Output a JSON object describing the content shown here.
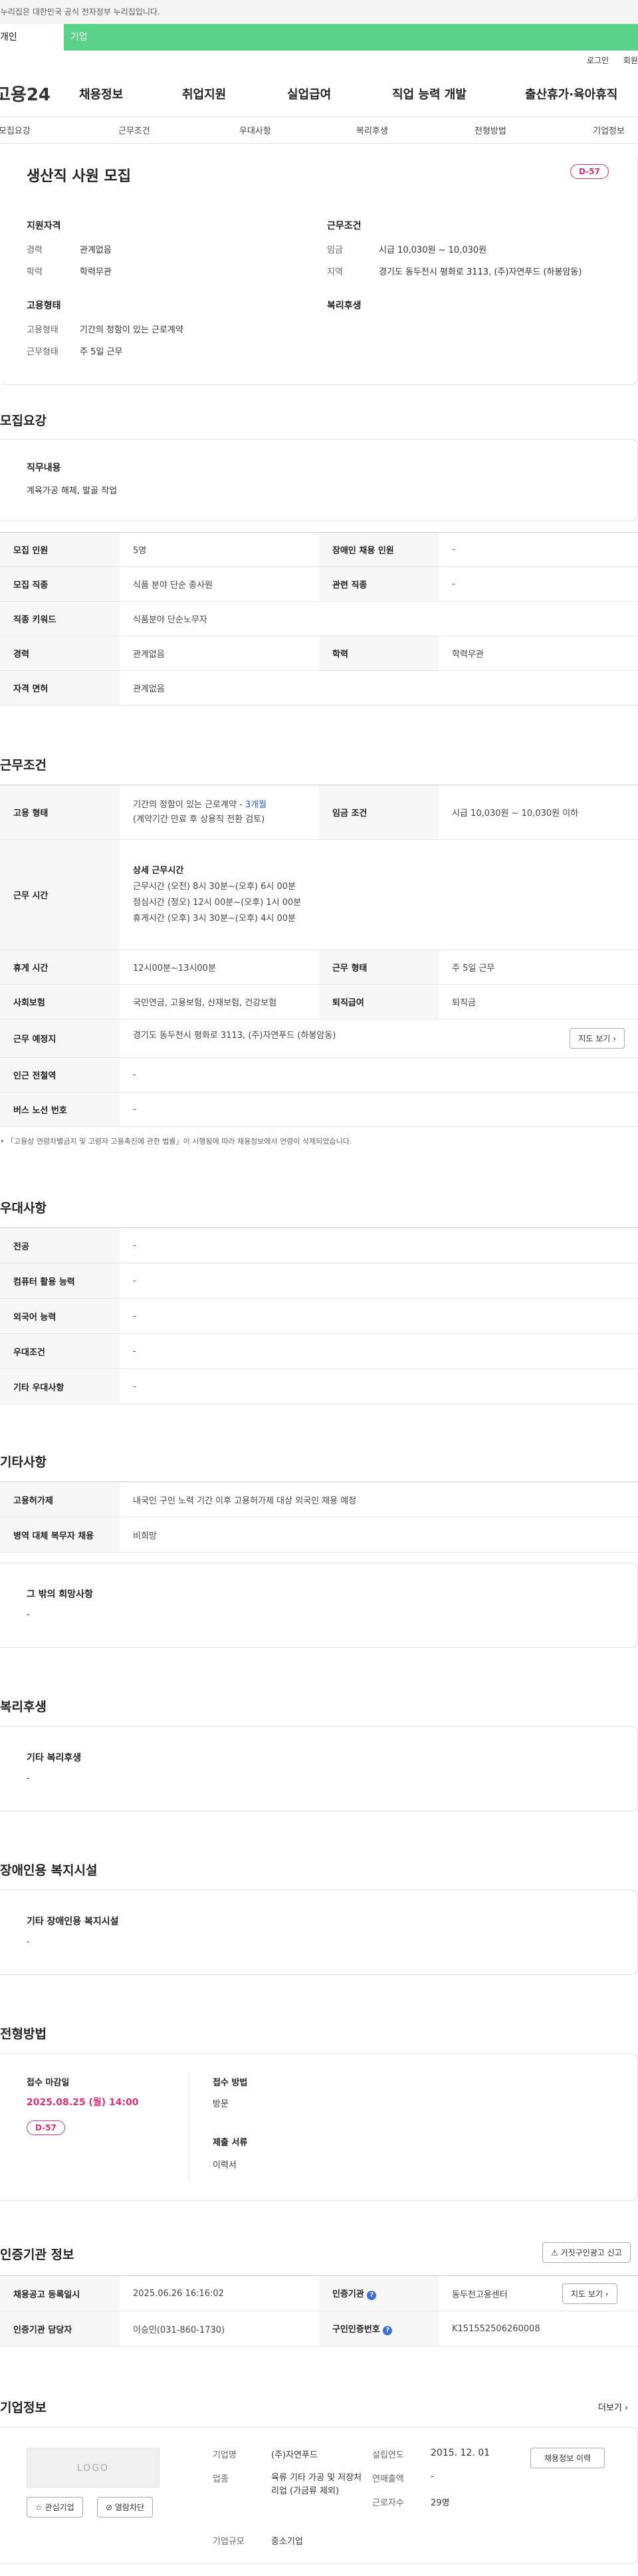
{
  "gov_bar": "이 누리집은 대한민국 공식 전자정부 누리집입니다.",
  "tabs": {
    "individual": "개인",
    "enterprise": "기업"
  },
  "util": {
    "login": "로그인",
    "signup": "회원가입"
  },
  "gnb": {
    "logo": "고용24",
    "menus": [
      "채용정보",
      "취업지원",
      "실업급여",
      "직업 능력 개발",
      "출산휴가·육아휴직"
    ]
  },
  "lnb": [
    "모집요강",
    "근무조건",
    "우대사항",
    "복리후생",
    "전형방법",
    "기업정보"
  ],
  "summary": {
    "title": "생산직 사원 모집",
    "dday": "D-57",
    "qualification_title": "지원자격",
    "career_label": "경력",
    "career_value": "관계없음",
    "education_label": "학력",
    "education_value": "학력무관",
    "conditions_title": "근무조건",
    "wage_label": "임금",
    "wage_value": "시급 10,030원 ~ 10,030원",
    "region_label": "지역",
    "region_value": "경기도 동두천시 평화로 3113, (주)자연푸드 (하봉암동)",
    "employment_title": "고용형태",
    "emp_type_label": "고용형태",
    "emp_type_value": "기간의 정함이 있는 근로계약",
    "work_form_label": "근무형태",
    "work_form_value": "주 5일 근무",
    "welfare_title": "복리후생"
  },
  "recruit": {
    "title": "모집요강",
    "duty_title": "직무내용",
    "duty_value": "계육가공  해체, 발골 작업",
    "rows": [
      {
        "k1": "모집 인원",
        "v1": "5명",
        "k2": "장애인 채용 인원",
        "v2": "-"
      },
      {
        "k1": "모집 직종",
        "v1": "식품 분야 단순 종사원",
        "k2": "관련 직종",
        "v2": "-"
      },
      {
        "k1": "직종 키워드",
        "v1": "식품분야 단순노무자"
      },
      {
        "k1": "경력",
        "v1": "관계없음",
        "k2": "학력",
        "v2": "학력무관"
      },
      {
        "k1": "자격 면허",
        "v1": "관계없음"
      }
    ]
  },
  "work": {
    "title": "근무조건",
    "emp_type_key": "고용 형태",
    "emp_type_v1": "기간의 정함이 있는 근로계약 - ",
    "emp_type_months": "3개월",
    "emp_type_v2": "(계약기간 만료 후 상용직 전환 검토)",
    "wage_key": "임금 조건",
    "wage_value": "시급 10,030원 ~ 10,030원 이하",
    "hours_key": "근무 시간",
    "hours_title": "상세 근무시간",
    "hours_lines": [
      "근무시간 (오전) 8시 30분~(오후) 6시 00분",
      "점심시간 (정오) 12시 00분~(오후) 1시 00분",
      "휴게시간 (오후) 3시 30분~(오후) 4시 00분"
    ],
    "rest_key": "휴게 시간",
    "rest_value": "12시00분~13시00분",
    "form_key": "근무 형태",
    "form_value": "주 5일 근무",
    "insurance_key": "사회보험",
    "insurance_value": "국민연금, 고용보험, 산재보험, 건강보험",
    "severance_key": "퇴직급여",
    "severance_value": "퇴직금",
    "place_key": "근무 예정지",
    "place_value": "경기도 동두천시 평화로 3113, (주)자연푸드 (하봉암동)",
    "map_button": "지도 보기",
    "subway_key": "인근 전철역",
    "subway_value": "-",
    "bus_key": "버스 노선 번호",
    "bus_value": "-",
    "note": "「고용상 연령차별금지 및 고령자 고용촉진에 관한 법률」이 시행됨에 따라 채용정보에서 연령이 삭제되었습니다."
  },
  "pref": {
    "title": "우대사항",
    "rows": [
      {
        "k": "전공",
        "v": "-"
      },
      {
        "k": "컴퓨터 활용 능력",
        "v": "-"
      },
      {
        "k": "외국어 능력",
        "v": "-"
      },
      {
        "k": "우대조건",
        "v": "-"
      },
      {
        "k": "기타 우대사항",
        "v": "-"
      }
    ]
  },
  "etc": {
    "title": "기타사항",
    "rows": [
      {
        "k": "고용허가제",
        "v": "내국인 구인 노력 기간 이후 고용허가제 대상 외국인 채용 예정"
      },
      {
        "k": "병역 대체 복무자 채용",
        "v": "비희망"
      }
    ],
    "other_title": "그 밖의 희망사항",
    "other_value": "-"
  },
  "welfare": {
    "title": "복리후생",
    "box_title": "기타 복리후생",
    "box_value": "-"
  },
  "disabled": {
    "title": "장애인용 복지시설",
    "box_title": "기타 장애인용 복지시설",
    "box_value": "-"
  },
  "selection": {
    "title": "전형방법",
    "deadline_label": "접수 마감일",
    "deadline_value": "2025.08.25 (월) 14:00",
    "dday": "D-57",
    "method_label": "접수 방법",
    "method_value": "방문",
    "docs_label": "제출 서류",
    "docs_value": "이력서"
  },
  "cert": {
    "title": "인증기관 정보",
    "report_button": "거짓구인광고 신고",
    "reg_date_key": "채용공고 등록일시",
    "reg_date_value": "2025.06.26 16:16:02",
    "agency_key": "인증기관",
    "agency_value": "동두천고용센터",
    "map_button": "지도 보기",
    "manager_key": "인증기관 담당자",
    "manager_value": "이승민(031-860-1730)",
    "number_key": "구인인증번호",
    "number_value": "K151552506260008"
  },
  "company": {
    "title": "기업정보",
    "more": "더보기",
    "logo": "LOGO",
    "interest_button": "관심기업",
    "block_button": "열람차단",
    "name_label": "기업명",
    "name_value": "(주)자연푸드",
    "industry_label": "업종",
    "industry_value": "육류 기타 가공 및 저장처리업 (가금류 제외)",
    "size_label": "기업규모",
    "size_value": "중소기업",
    "founded_label": "설립연도",
    "founded_value": "2015. 12. 01",
    "sales_label": "연매출액",
    "sales_value": "-",
    "employees_label": "근로자수",
    "employees_value": "29명",
    "history_button": "채용정보 이력"
  }
}
